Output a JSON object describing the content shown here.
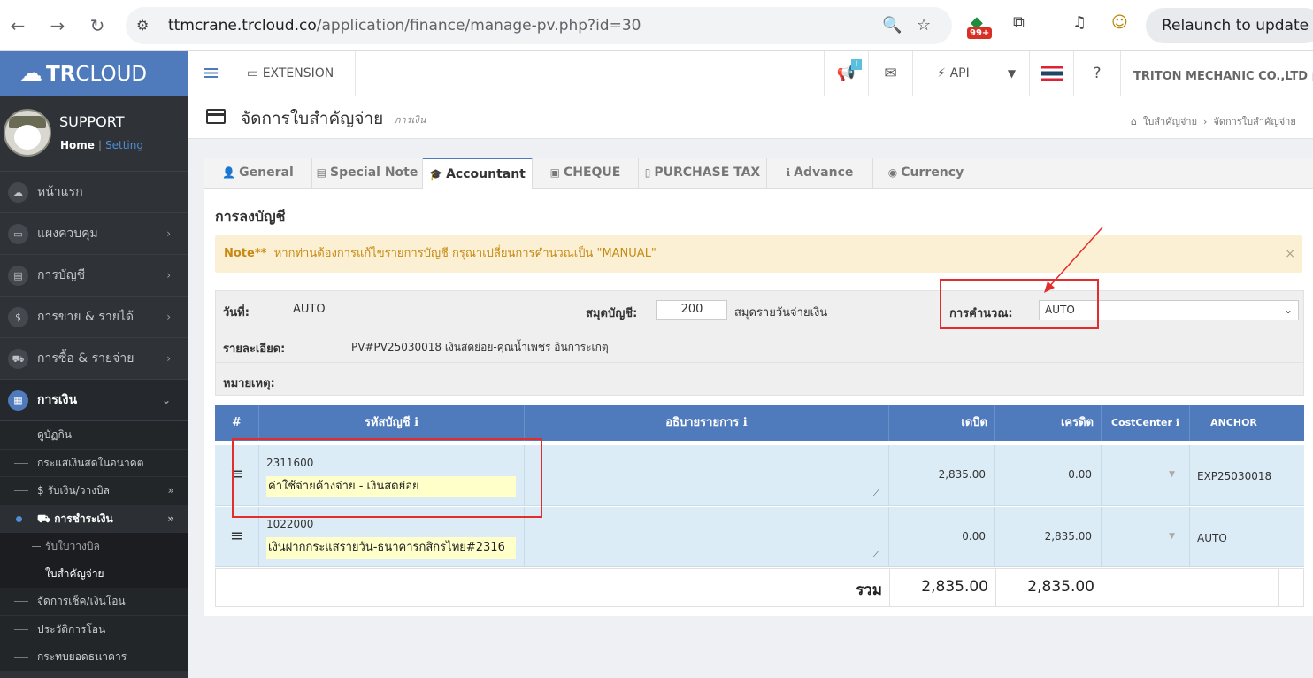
{
  "browser": {
    "url_host": "ttmcrane.trcloud.co",
    "url_path": "/application/finance/manage-pv.php?id=30",
    "ext_badge": "99+",
    "relaunch_label": "Relaunch to update"
  },
  "sidebar": {
    "logo_tr": "TR",
    "logo_cloud": "CLOUD",
    "user_name": "SUPPORT",
    "home_link": "Home",
    "setting_link": "Setting",
    "menu": [
      {
        "label": "หน้าแรก"
      },
      {
        "label": "แผงควบคุม"
      },
      {
        "label": "การบัญชี"
      },
      {
        "label": "การขาย & รายได้"
      },
      {
        "label": "การซื้อ & รายจ่าย"
      },
      {
        "label": "การเงิน"
      }
    ],
    "submenu": [
      {
        "label": "ดูบัฏกิน"
      },
      {
        "label": "กระแสเงินสดในอนาคต"
      },
      {
        "label": "$ รับเงิน/วางบิล"
      },
      {
        "label": "การชำระเงิน"
      }
    ],
    "subsub": [
      {
        "label": "รับใบวางบิล"
      },
      {
        "label": "ใบสำคัญจ่าย"
      }
    ],
    "more": [
      {
        "label": "จัดการเช็ค/เงินโอน"
      },
      {
        "label": "ประวัติการโอน"
      },
      {
        "label": "กระทบยอดธนาคาร"
      }
    ]
  },
  "topbar": {
    "extension_label": "EXTENSION",
    "api_label": "API",
    "company": "TRITON MECHANIC CO.,LTD",
    "new_mark": "!"
  },
  "page": {
    "title": "จัดการใบสำคัญจ่าย",
    "subtitle": "การเงิน",
    "breadcrumb_1": "ใบสำคัญจ่าย",
    "breadcrumb_2": "จัดการใบสำคัญจ่าย"
  },
  "tabs": [
    {
      "label": "General"
    },
    {
      "label": "Special Note"
    },
    {
      "label": "Accountant"
    },
    {
      "label": "CHEQUE"
    },
    {
      "label": "PURCHASE TAX"
    },
    {
      "label": "Advance"
    },
    {
      "label": "Currency"
    }
  ],
  "section_title": "การลงบัญชี",
  "note": {
    "prefix": "Note**",
    "text": "หากท่านต้องการแก้ไขรายการบัญชี กรุณาเปลี่ยนการคำนวณเป็น \"MANUAL\"",
    "close": "×"
  },
  "info": {
    "date_label": "วันที่:",
    "date_value": "AUTO",
    "book_label": "สมุดบัญชี:",
    "book_value": "200",
    "book_name": "สมุดรายวันจ่ายเงิน",
    "calc_label": "การคำนวณ:",
    "calc_value": "AUTO",
    "detail_label": "รายละเอียด:",
    "detail_value": "PV#PV25030018 เงินสดย่อย-คุณน้ำเพชร อินการะเกตุ",
    "remark_label": "หมายเหตุ:"
  },
  "grid": {
    "headers": {
      "hash": "#",
      "account": "รหัสบัญชี",
      "desc": "อธิบายรายการ",
      "debit": "เดบิต",
      "credit": "เครดิต",
      "costcenter": "CostCenter",
      "anchor": "ANCHOR"
    },
    "rows": [
      {
        "code": "2311600",
        "name": "ค่าใช้จ่ายค้างจ่าย - เงินสดย่อย",
        "debit": "2,835.00",
        "credit": "0.00",
        "anchor": "EXP25030018"
      },
      {
        "code": "1022000",
        "name": "เงินฝากกระแสรายวัน-ธนาคารกสิกรไทย#2316",
        "debit": "0.00",
        "credit": "2,835.00",
        "anchor": "AUTO"
      }
    ],
    "total_label": "รวม",
    "total_debit": "2,835.00",
    "total_credit": "2,835.00"
  }
}
